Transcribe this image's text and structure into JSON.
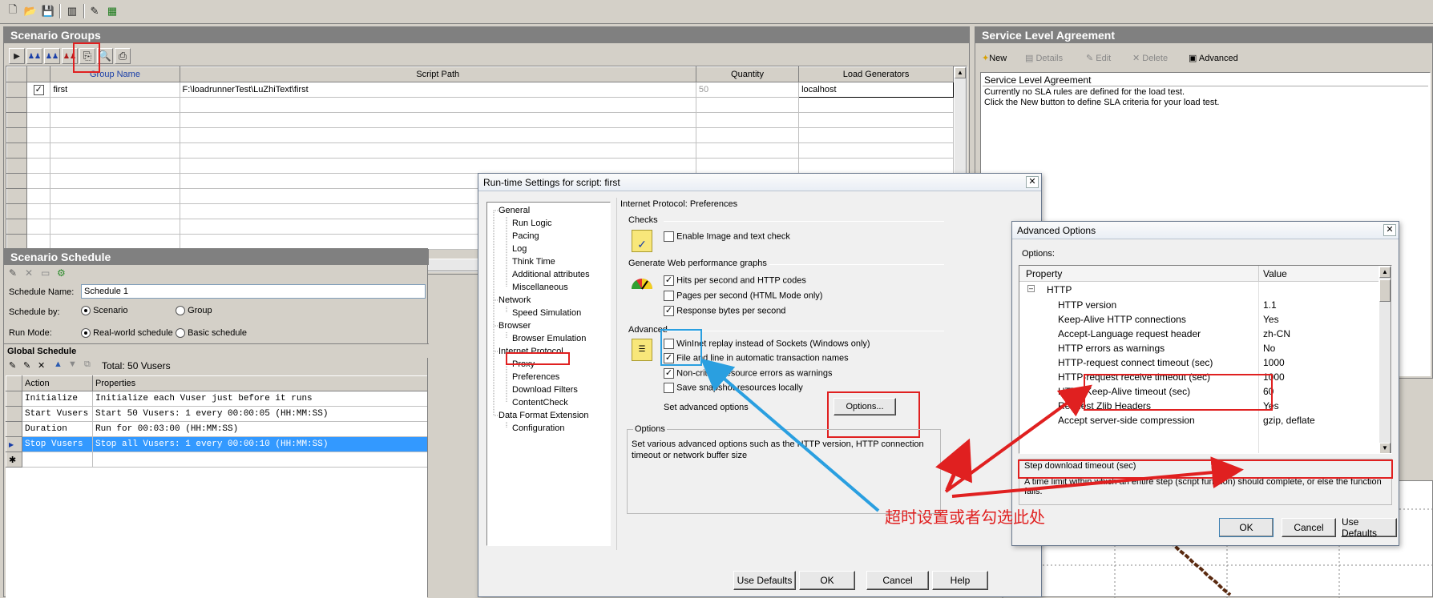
{
  "icons": {
    "new": "new-doc-icon",
    "open": "open-folder-icon",
    "save": "save-disk-icon",
    "generators": "load-generator-icon",
    "script": "script-edit-icon",
    "grid": "grid-icon"
  },
  "colors": {
    "selection": "#3399ff",
    "annotation_red": "#e02020",
    "annotation_blue": "#2a9fe0"
  },
  "scenario_groups": {
    "title": "Scenario Groups",
    "columns": [
      "Group Name",
      "Script Path",
      "Quantity",
      "Load Generators"
    ],
    "rows": [
      {
        "name": "first",
        "path": "F:\\loadrunnerTest\\LuZhiText\\first",
        "quantity": "50",
        "generators": "localhost",
        "checked": true
      }
    ]
  },
  "sla": {
    "title": "Service Level Agreement",
    "toolbar": {
      "new": "New",
      "details": "Details",
      "edit": "Edit",
      "delete": "Delete",
      "advanced": "Advanced"
    },
    "box_title": "Service Level Agreement",
    "line1": "Currently no SLA rules are defined for the load test.",
    "line2": "Click the New button to define SLA criteria for your load test."
  },
  "schedule": {
    "title": "Scenario Schedule",
    "name_label": "Schedule Name:",
    "name_value": "Schedule 1",
    "by_label": "Schedule by:",
    "by_scenario": "Scenario",
    "by_group": "Group",
    "mode_label": "Run Mode:",
    "mode_real": "Real-world schedule",
    "mode_basic": "Basic schedule",
    "global_title": "Global Schedule",
    "total": "Total: 50 Vusers",
    "col_action": "Action",
    "col_properties": "Properties",
    "rows": [
      {
        "action": "Initialize",
        "props": "Initialize each Vuser just before it runs"
      },
      {
        "action": "Start  Vusers",
        "props": "Start 50 Vusers: 1 every 00:00:05 (HH:MM:SS)"
      },
      {
        "action": "Duration",
        "props": "Run for 00:03:00 (HH:MM:SS)"
      },
      {
        "action": "Stop Vusers",
        "props": "Stop all Vusers: 1 every 00:00:10 (HH:MM:SS)"
      }
    ]
  },
  "runtime": {
    "title": "Run-time Settings for script: first",
    "tree": {
      "general": "General",
      "run_logic": "Run Logic",
      "pacing": "Pacing",
      "log": "Log",
      "think_time": "Think Time",
      "additional": "Additional attributes",
      "misc": "Miscellaneous",
      "network": "Network",
      "speed": "Speed Simulation",
      "browser": "Browser",
      "browser_emulation": "Browser Emulation",
      "internet_protocol": "Internet Protocol",
      "proxy": "Proxy",
      "preferences": "Preferences",
      "download_filters": "Download Filters",
      "content_check": "ContentCheck",
      "data_format": "Data Format Extension",
      "configuration": "Configuration"
    },
    "page_title": "Internet Protocol: Preferences",
    "checks_label": "Checks",
    "enable_image": "Enable Image and text check",
    "graphs_label": "Generate Web performance graphs",
    "hits": "Hits per second and HTTP codes",
    "pages": "Pages per second (HTML Mode only)",
    "response_bytes": "Response bytes per second",
    "advanced_label": "Advanced",
    "wininet": "WinInet replay instead of Sockets (Windows only)",
    "file_line": "File and line in automatic transaction names",
    "non_critical": "Non-critical resource errors as warnings",
    "save_snapshot": "Save snapshot resources locally",
    "set_advanced": "Set advanced options",
    "options_button": "Options...",
    "options_group": "Options",
    "options_desc": "Set various advanced options such as the HTTP version, HTTP connection timeout or network buffer size",
    "use_defaults": "Use Defaults",
    "ok": "OK",
    "cancel": "Cancel",
    "help": "Help"
  },
  "advanced": {
    "title": "Advanced Options",
    "options_label": "Options:",
    "col_property": "Property",
    "col_value": "Value",
    "group": "HTTP",
    "props": [
      {
        "name": "HTTP version",
        "value": "1.1"
      },
      {
        "name": "Keep-Alive HTTP connections",
        "value": "Yes"
      },
      {
        "name": "Accept-Language request header",
        "value": "zh-CN"
      },
      {
        "name": "HTTP errors as warnings",
        "value": "No"
      },
      {
        "name": "HTTP-request connect timeout (sec)",
        "value": "1000"
      },
      {
        "name": "HTTP-request receive timeout (sec)",
        "value": "1000"
      },
      {
        "name": "HTTP Keep-Alive timeout (sec)",
        "value": "60"
      },
      {
        "name": "Request Zlib Headers",
        "value": "Yes"
      },
      {
        "name": "Accept server-side compression",
        "value": "gzip, deflate"
      }
    ],
    "desc_title": "Step download timeout (sec)",
    "desc_text": "A time limit within which an entire step (script function) should complete, or else the function fails.",
    "ok": "OK",
    "cancel": "Cancel",
    "use_defaults": "Use Defaults"
  },
  "annotation": {
    "text": "超时设置或者勾选此处"
  }
}
